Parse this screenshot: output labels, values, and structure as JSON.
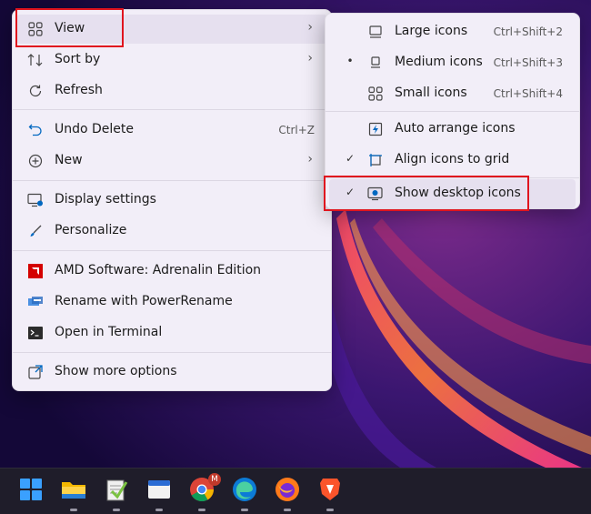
{
  "main_menu": {
    "items": [
      {
        "label": "View",
        "shortcut": "",
        "arrow": "›",
        "icon": "grid-icon"
      },
      {
        "label": "Sort by",
        "shortcut": "",
        "arrow": "›",
        "icon": "sort-icon"
      },
      {
        "label": "Refresh",
        "shortcut": "",
        "arrow": "",
        "icon": "refresh-icon"
      },
      {
        "label": "Undo Delete",
        "shortcut": "Ctrl+Z",
        "arrow": "",
        "icon": "undo-icon"
      },
      {
        "label": "New",
        "shortcut": "",
        "arrow": "›",
        "icon": "plus-circle-icon"
      },
      {
        "label": "Display settings",
        "shortcut": "",
        "arrow": "",
        "icon": "display-icon"
      },
      {
        "label": "Personalize",
        "shortcut": "",
        "arrow": "",
        "icon": "brush-icon"
      },
      {
        "label": "AMD Software: Adrenalin Edition",
        "shortcut": "",
        "arrow": "",
        "icon": "amd-icon"
      },
      {
        "label": "Rename with PowerRename",
        "shortcut": "",
        "arrow": "",
        "icon": "powerrename-icon"
      },
      {
        "label": "Open in Terminal",
        "shortcut": "",
        "arrow": "",
        "icon": "terminal-icon"
      },
      {
        "label": "Show more options",
        "shortcut": "",
        "arrow": "",
        "icon": "share-icon"
      }
    ]
  },
  "view_submenu": {
    "items": [
      {
        "label": "Large icons",
        "shortcut": "Ctrl+Shift+2",
        "mark": "",
        "icon": "large-icons-icon"
      },
      {
        "label": "Medium icons",
        "shortcut": "Ctrl+Shift+3",
        "mark": "•",
        "icon": "medium-icons-icon"
      },
      {
        "label": "Small icons",
        "shortcut": "Ctrl+Shift+4",
        "mark": "",
        "icon": "small-icons-icon"
      },
      {
        "label": "Auto arrange icons",
        "shortcut": "",
        "mark": "",
        "icon": "auto-arrange-icon"
      },
      {
        "label": "Align icons to grid",
        "shortcut": "",
        "mark": "✓",
        "icon": "align-grid-icon"
      },
      {
        "label": "Show desktop icons",
        "shortcut": "",
        "mark": "✓",
        "icon": "show-desktop-icon"
      }
    ]
  },
  "taskbar": {
    "chrome_badge": "M",
    "apps": [
      "windows-start-icon",
      "file-explorer-icon",
      "notepad-plus-icon",
      "app-window-icon",
      "chrome-icon",
      "edge-icon",
      "firefox-icon",
      "brave-icon"
    ]
  },
  "colors": {
    "highlight_box": "#e0141e",
    "menu_bg": "#f2eef8",
    "accent": "#0067c0"
  }
}
